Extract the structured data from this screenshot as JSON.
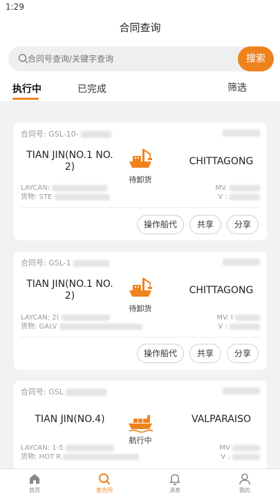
{
  "status_bar": {
    "time": "1:29"
  },
  "header": {
    "title": "合同查询"
  },
  "search": {
    "placeholder": "合同号查询/关键字查询",
    "button_label": "搜索"
  },
  "tabs": {
    "items": [
      {
        "label": "执行中"
      },
      {
        "label": "已完成"
      }
    ],
    "filter_label": "筛选"
  },
  "cards": [
    {
      "contract_label": "合同号: GSL-10-",
      "origin": "TIAN JIN(NO.1 NO.\n2)",
      "destination": "CHITTAGONG",
      "status": "待卸货",
      "laycan": "LAYCAN:",
      "cargo": "货物: STE",
      "vessel": "MV.",
      "voyage": "V :",
      "buttons": [
        "操作船代",
        "共享",
        "分享"
      ]
    },
    {
      "contract_label": "合同号: GSL-1",
      "origin": "TIAN JIN(NO.1 NO.\n2)",
      "destination": "CHITTAGONG",
      "status": "待卸货",
      "laycan": "LAYCAN: 2(",
      "cargo": "货物: GALV",
      "vessel": "MV. I",
      "voyage": "V :",
      "buttons": [
        "操作船代",
        "共享",
        "分享"
      ]
    },
    {
      "contract_label": "合同号: GSL",
      "origin": "TIAN JIN(NO.4)",
      "destination": "VALPARAISO",
      "status": "航行中",
      "laycan": "LAYCAN: 1-5",
      "cargo": "货物: HOT R",
      "vessel": "MV",
      "voyage": "V :"
    }
  ],
  "bottom_nav": [
    {
      "label": "首页",
      "icon": "home-icon"
    },
    {
      "label": "查合同",
      "icon": "search-icon"
    },
    {
      "label": "消息",
      "icon": "bell-icon"
    },
    {
      "label": "我的",
      "icon": "user-icon"
    }
  ],
  "colors": {
    "accent": "#f0821e",
    "background": "#f2f2f2"
  }
}
